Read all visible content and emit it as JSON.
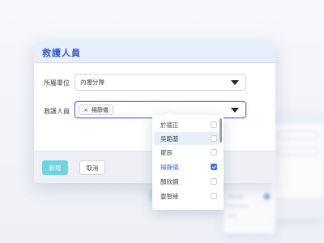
{
  "modal": {
    "title": "救護人員",
    "fields": {
      "unit": {
        "label": "所屬單位",
        "value": "內壢分隊"
      },
      "personnel": {
        "label": "救護人員",
        "tag": "楊靜儀",
        "tag_remove": "×"
      }
    },
    "buttons": {
      "add": "新增",
      "cancel": "取消"
    }
  },
  "dropdown": {
    "options": [
      {
        "label": "於德正",
        "checked": false
      },
      {
        "label": "吳韜基",
        "checked": false,
        "hover": true
      },
      {
        "label": "翟辰",
        "checked": false
      },
      {
        "label": "楊靜儀",
        "checked": true
      },
      {
        "label": "顏欣鋼",
        "checked": false
      },
      {
        "label": "豐智綾",
        "checked": false
      }
    ]
  },
  "background_list": {
    "rows": [
      "Yang Jing",
      "Yan Xingang",
      "Feng"
    ]
  },
  "colors": {
    "accent": "#3b6fe0",
    "primary_button": "#6fd3e3",
    "header_bg": "#e9eefb"
  }
}
